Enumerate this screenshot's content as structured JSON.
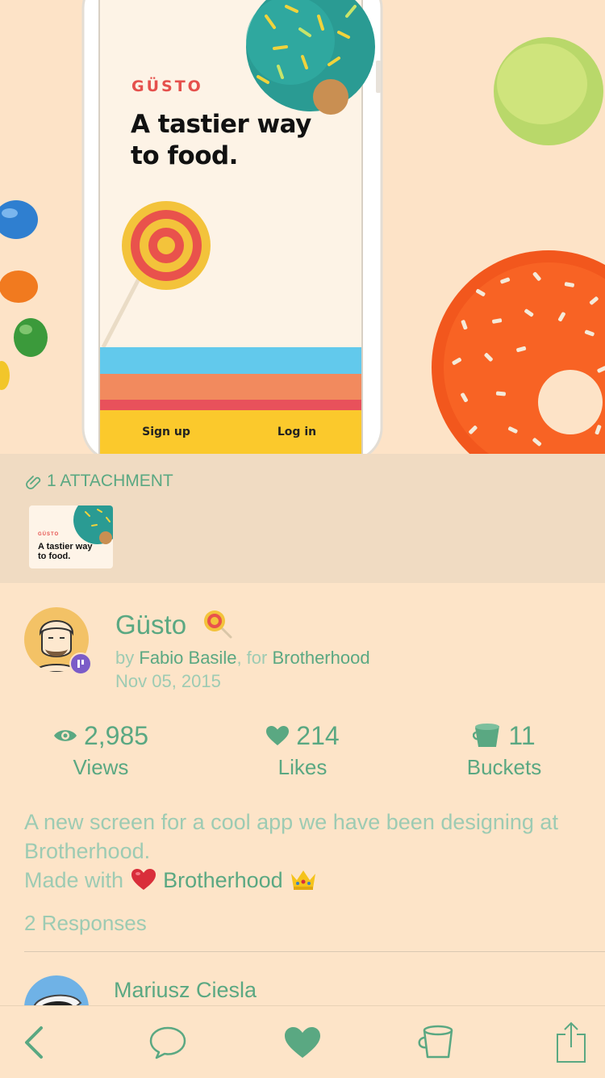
{
  "hero": {
    "brand": "GÜSTO",
    "tagline": "A tastier way to food.",
    "signup_label": "Sign up",
    "login_label": "Log in"
  },
  "attachments": {
    "header": "1 ATTACHMENT",
    "thumb_brand": "GÜSTO",
    "thumb_tagline": "A tastier way to food."
  },
  "shot": {
    "title": "Güsto",
    "title_emoji": "lollipop-icon",
    "by_prefix": "by",
    "author": "Fabio Basile",
    "for_prefix": ", for",
    "team": "Brotherhood",
    "date": "Nov 05, 2015"
  },
  "stats": {
    "views": {
      "value": "2,985",
      "label": "Views",
      "icon": "eye-icon"
    },
    "likes": {
      "value": "214",
      "label": "Likes",
      "icon": "heart-icon"
    },
    "buckets": {
      "value": "11",
      "label": "Buckets",
      "icon": "bucket-icon"
    }
  },
  "description": {
    "text": "A new screen for a cool app we have been designing at Brotherhood.",
    "made_with": "Made with",
    "made_with_link": "Brotherhood"
  },
  "responses": {
    "title": "2 Responses",
    "items": [
      {
        "author": "Mariusz Ciesla"
      }
    ]
  },
  "toolbar": {
    "items": [
      "back-icon",
      "comment-icon",
      "like-icon",
      "bucket-icon",
      "share-icon"
    ]
  },
  "colors": {
    "background": "#fde4c8",
    "accent": "#5aa882",
    "muted": "#9dcbb3",
    "attachment_bg": "#f0dbc2",
    "brand_red": "#e5504c"
  }
}
